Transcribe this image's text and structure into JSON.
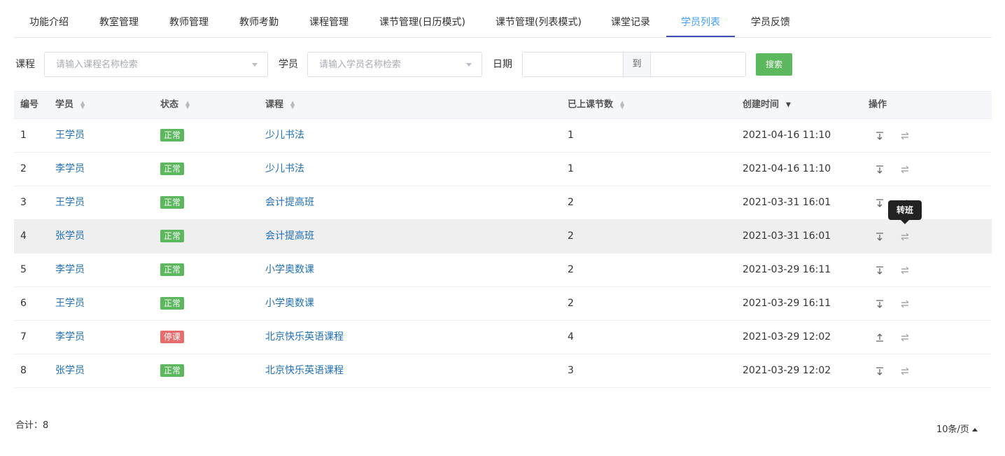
{
  "tabs": [
    {
      "label": "功能介绍",
      "active": false
    },
    {
      "label": "教室管理",
      "active": false
    },
    {
      "label": "教师管理",
      "active": false
    },
    {
      "label": "教师考勤",
      "active": false
    },
    {
      "label": "课程管理",
      "active": false
    },
    {
      "label": "课节管理(日历模式)",
      "active": false
    },
    {
      "label": "课节管理(列表模式)",
      "active": false
    },
    {
      "label": "课堂记录",
      "active": false
    },
    {
      "label": "学员列表",
      "active": true
    },
    {
      "label": "学员反馈",
      "active": false
    }
  ],
  "filters": {
    "course_label": "课程",
    "course_placeholder": "请输入课程名称检索",
    "student_label": "学员",
    "student_placeholder": "请输入学员名称检索",
    "date_label": "日期",
    "date_separator": "到",
    "search_button": "搜索"
  },
  "table": {
    "headers": {
      "id": "编号",
      "student": "学员",
      "status": "状态",
      "course": "课程",
      "lessons": "已上课节数",
      "created": "创建时间",
      "actions": "操作"
    },
    "rows": [
      {
        "id": "1",
        "student": "王学员",
        "status": "正常",
        "status_type": "ok",
        "course": "少儿书法",
        "lessons": "1",
        "created": "2021-04-16 11:10"
      },
      {
        "id": "2",
        "student": "李学员",
        "status": "正常",
        "status_type": "ok",
        "course": "少儿书法",
        "lessons": "1",
        "created": "2021-04-16 11:10"
      },
      {
        "id": "3",
        "student": "王学员",
        "status": "正常",
        "status_type": "ok",
        "course": "会计提高班",
        "lessons": "2",
        "created": "2021-03-31 16:01"
      },
      {
        "id": "4",
        "student": "张学员",
        "status": "正常",
        "status_type": "ok",
        "course": "会计提高班",
        "lessons": "2",
        "created": "2021-03-31 16:01"
      },
      {
        "id": "5",
        "student": "李学员",
        "status": "正常",
        "status_type": "ok",
        "course": "小学奥数课",
        "lessons": "2",
        "created": "2021-03-29 16:11"
      },
      {
        "id": "6",
        "student": "王学员",
        "status": "正常",
        "status_type": "ok",
        "course": "小学奥数课",
        "lessons": "2",
        "created": "2021-03-29 16:11"
      },
      {
        "id": "7",
        "student": "李学员",
        "status": "停课",
        "status_type": "stop",
        "course": "北京快乐英语课程",
        "lessons": "4",
        "created": "2021-03-29 12:02"
      },
      {
        "id": "8",
        "student": "张学员",
        "status": "正常",
        "status_type": "ok",
        "course": "北京快乐英语课程",
        "lessons": "3",
        "created": "2021-03-29 12:02"
      }
    ]
  },
  "tooltip": "转班",
  "footer": {
    "total": "合计：8",
    "page_size": "10条/页"
  },
  "colors": {
    "link": "#1e6fb8",
    "status_ok": "#5cb85c",
    "status_stop": "#e86c6c",
    "search_button": "#5cb85c"
  }
}
